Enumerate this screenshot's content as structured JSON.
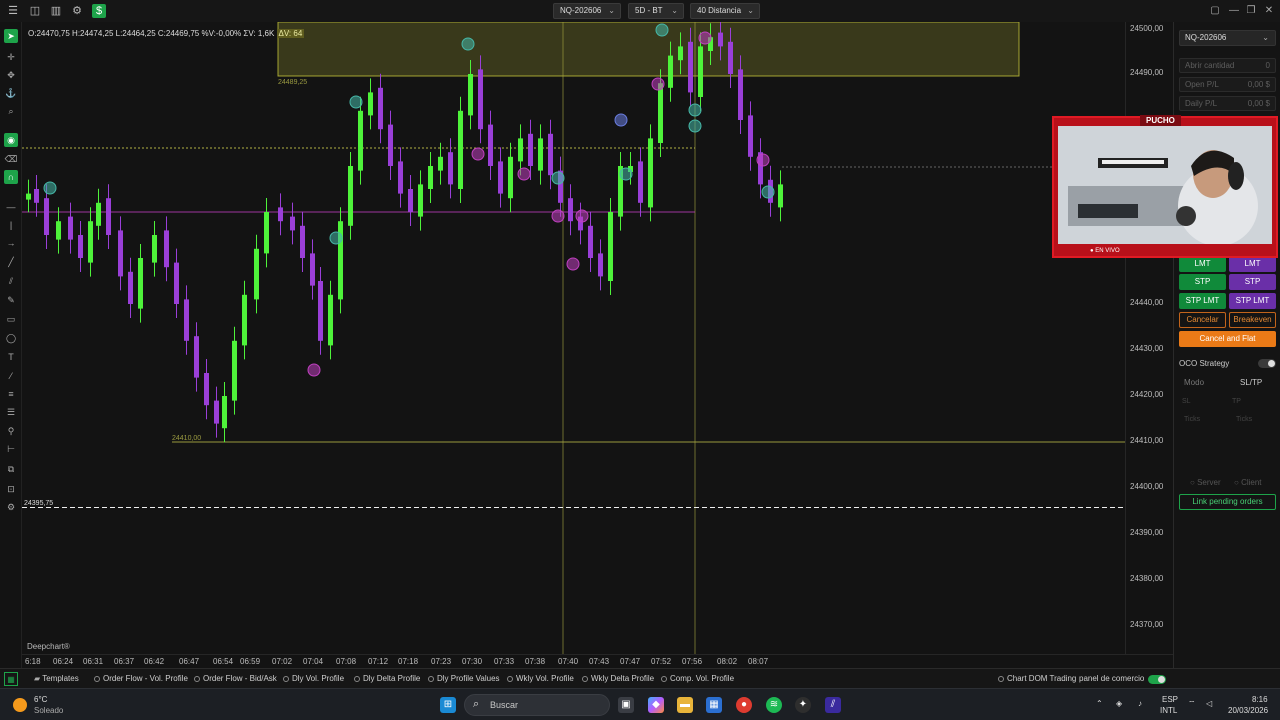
{
  "toolbar": {
    "instrument": "NQ-202606",
    "timeframe": "5D - BT",
    "distance": "40 Distancia"
  },
  "chart": {
    "ohlc_prefix": "O:24470,75  H:24474,25  L:24464,25  C:24469,75  %V:-0,00%  ΣV: 1,6K",
    "ohlc_delta": "ΔV: 64",
    "zone_label": "24489,25",
    "level_label": "24410,00",
    "dashed_label": "24395,75",
    "watermark": "Deepchart®",
    "price_labels": [
      "24500,00",
      "24490,00",
      "24440,00",
      "24430,00",
      "24420,00",
      "24410,00",
      "24400,00",
      "24390,00",
      "24380,00",
      "24370,00"
    ],
    "time_labels": [
      "6:18",
      "06:24",
      "06:31",
      "06:37",
      "06:42",
      "06:47",
      "06:54",
      "06:59",
      "07:02",
      "07:04",
      "07:08",
      "07:12",
      "07:18",
      "07:23",
      "07:30",
      "07:33",
      "07:38",
      "07:40",
      "07:43",
      "07:47",
      "07:52",
      "07:56",
      "08:02",
      "08:07"
    ],
    "colors": {
      "up": "#4ef33a",
      "down": "#9a3fd8",
      "zone": "#c5c53a",
      "level": "#a8a843",
      "magenta": "#c040c0"
    }
  },
  "order_panel": {
    "instrument": "NQ-202606",
    "open_qty_label": "Abrir cantidad",
    "open_qty_value": "0",
    "open_pl_label": "Open P/L",
    "open_pl_value": "0,00 $",
    "daily_pl_label": "Daily P/L",
    "daily_pl_value": "0,00 $",
    "lmt": "LMT",
    "stp": "STP",
    "stp_lmt": "STP LMT",
    "cancel": "Cancelar",
    "breakeven": "Breakeven",
    "cancel_flat": "Cancel and Flat",
    "oco": "OCO Strategy",
    "modo_label": "Modo",
    "modo_value": "SL/TP",
    "sl": "SL",
    "tp": "TP",
    "ticks": "Ticks",
    "server": "Server",
    "client": "Client",
    "link_pending": "Link pending orders"
  },
  "webcam": {
    "name": "PUCHO",
    "live": "● EN VIVO"
  },
  "bottom_bar": {
    "templates": "Templates",
    "indicators": [
      "Order Flow - Vol. Profile",
      "Order Flow - Bid/Ask",
      "Dly Vol. Profile",
      "Dly Delta Profile",
      "Dly Profile Values",
      "Wkly Vol. Profile",
      "Wkly Delta Profile",
      "Comp. Vol. Profile"
    ],
    "chart_dom": "Chart DOM Trading",
    "panel": "panel de comercio"
  },
  "taskbar": {
    "weather_temp": "6°C",
    "weather_desc": "Soleado",
    "search_placeholder": "Buscar",
    "lang_1": "ESP",
    "lang_2": "INTL",
    "time": "8:16",
    "date": "20/03/2026"
  }
}
